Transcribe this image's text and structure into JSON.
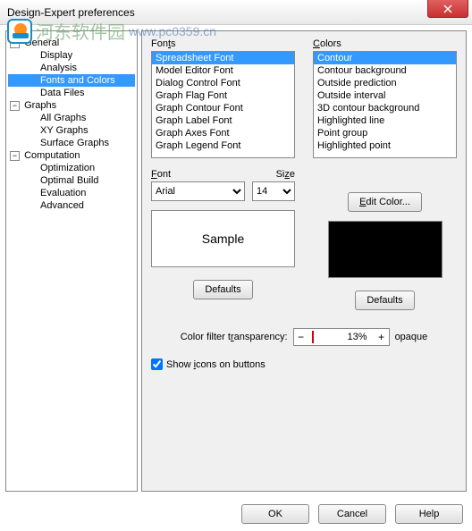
{
  "window": {
    "title": "Design-Expert preferences"
  },
  "watermark": {
    "text": "河东软件园",
    "url": "www.pc0359.cn"
  },
  "tree": {
    "groups": [
      {
        "label": "General",
        "items": [
          "Display",
          "Analysis",
          "Fonts and Colors",
          "Data Files"
        ],
        "selected": "Fonts and Colors"
      },
      {
        "label": "Graphs",
        "items": [
          "All Graphs",
          "XY Graphs",
          "Surface Graphs"
        ]
      },
      {
        "label": "Computation",
        "items": [
          "Optimization",
          "Optimal Build",
          "Evaluation",
          "Advanced"
        ]
      }
    ]
  },
  "fonts": {
    "group_label": "Fonts",
    "list": [
      "Spreadsheet Font",
      "Model Editor Font",
      "Dialog Control Font",
      "Graph Flag Font",
      "Graph Contour Font",
      "Graph Label Font",
      "Graph Axes Font",
      "Graph Legend Font"
    ],
    "selected": "Spreadsheet Font",
    "font_label": "Font",
    "size_label": "Size",
    "font_value": "Arial",
    "size_value": "14",
    "sample": "Sample",
    "defaults": "Defaults"
  },
  "colors": {
    "group_label": "Colors",
    "list": [
      "Contour",
      "Contour background",
      "Outside prediction",
      "Outside interval",
      "3D contour background",
      "Highlighted line",
      "Point group",
      "Highlighted point"
    ],
    "selected": "Contour",
    "edit": "Edit Color...",
    "preview": "#000000",
    "defaults": "Defaults"
  },
  "transparency": {
    "label": "Color filter transparency:",
    "value": "13%",
    "suffix": "opaque"
  },
  "show_icons": {
    "label": "Show icons on buttons",
    "checked": true
  },
  "footer": {
    "ok": "OK",
    "cancel": "Cancel",
    "help": "Help"
  }
}
